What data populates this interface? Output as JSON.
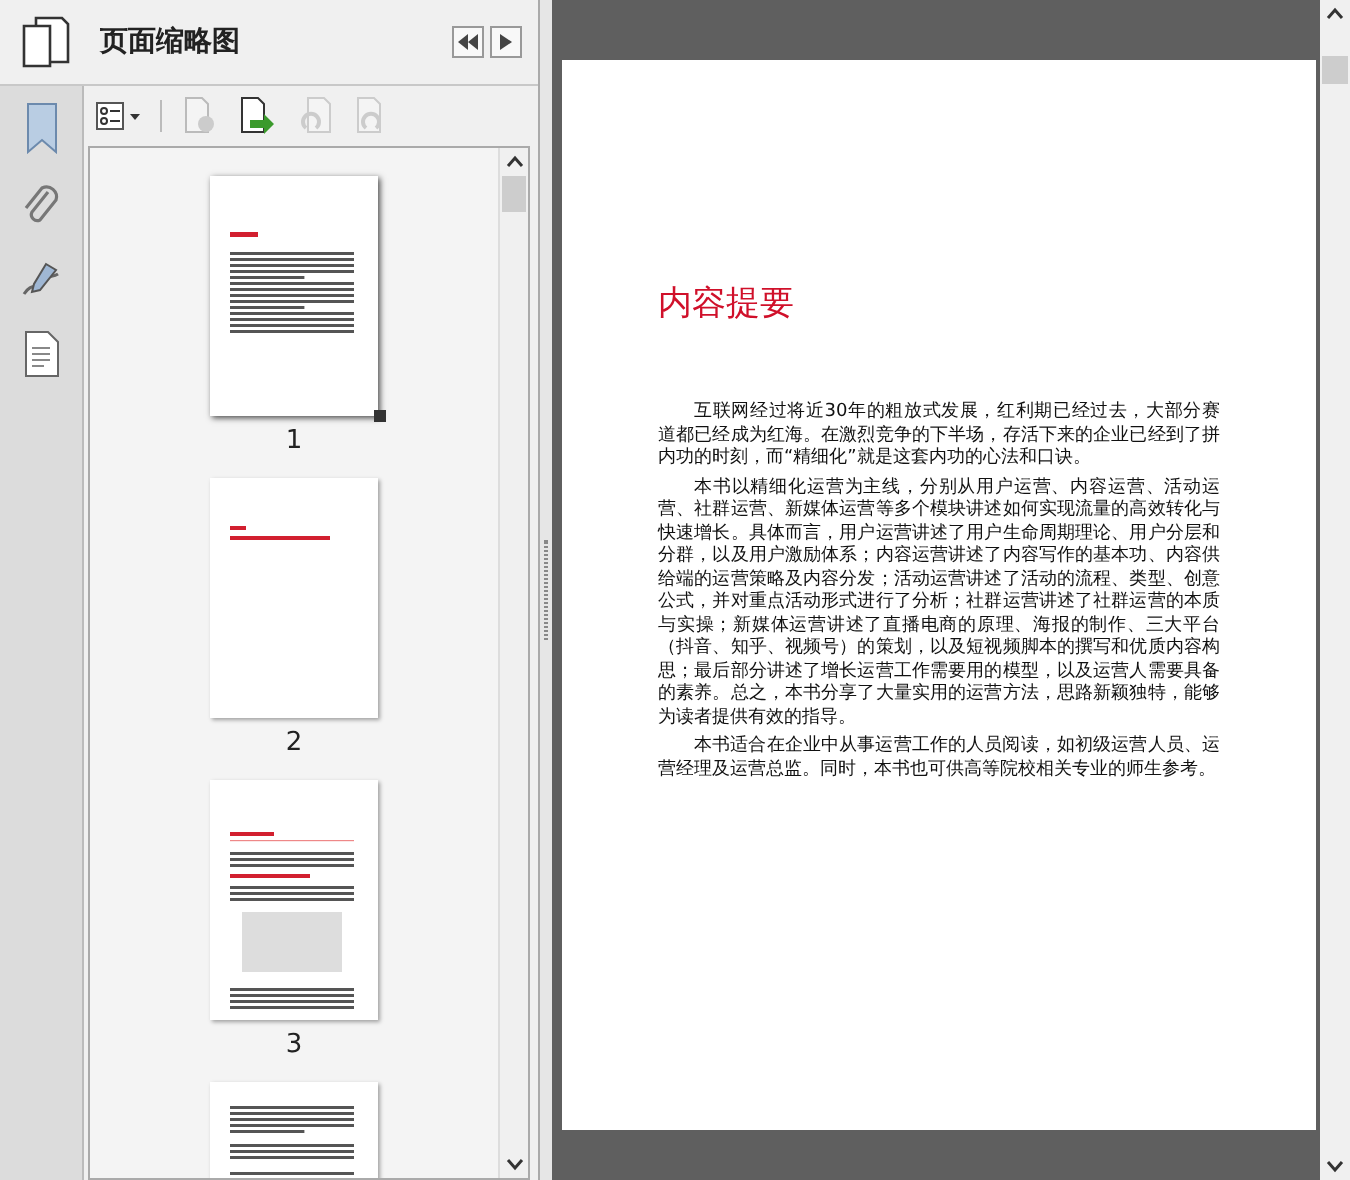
{
  "panel": {
    "title": "页面缩略图"
  },
  "thumbnails": [
    {
      "label": "1",
      "selected": true,
      "kind": "summary"
    },
    {
      "label": "2",
      "selected": false,
      "kind": "chapter"
    },
    {
      "label": "3",
      "selected": false,
      "kind": "table"
    },
    {
      "selected": false,
      "kind": "text"
    }
  ],
  "document": {
    "heading": "内容提要",
    "paragraphs": [
      "互联网经过将近30年的粗放式发展，红利期已经过去，大部分赛道都已经成为红海。在激烈竞争的下半场，存活下来的企业已经到了拼内功的时刻，而“精细化”就是这套内功的心法和口诀。",
      "本书以精细化运营为主线，分别从用户运营、内容运营、活动运营、社群运营、新媒体运营等多个模块讲述如何实现流量的高效转化与快速增长。具体而言，用户运营讲述了用户生命周期理论、用户分层和分群，以及用户激励体系；内容运营讲述了内容写作的基本功、内容供给端的运营策略及内容分发；活动运营讲述了活动的流程、类型、创意公式，并对重点活动形式进行了分析；社群运营讲述了社群运营的本质与实操；新媒体运营讲述了直播电商的原理、海报的制作、三大平台（抖音、知乎、视频号）的策划，以及短视频脚本的撰写和优质内容构思；最后部分讲述了增长运营工作需要用的模型，以及运营人需要具备的素养。总之，本书分享了大量实用的运营方法，思路新颖独特，能够为读者提供有效的指导。",
      "本书适合在企业中从事运营工作的人员阅读，如初级运营人员、运营经理及运营总监。同时，本书也可供高等院校相关专业的师生参考。"
    ]
  }
}
